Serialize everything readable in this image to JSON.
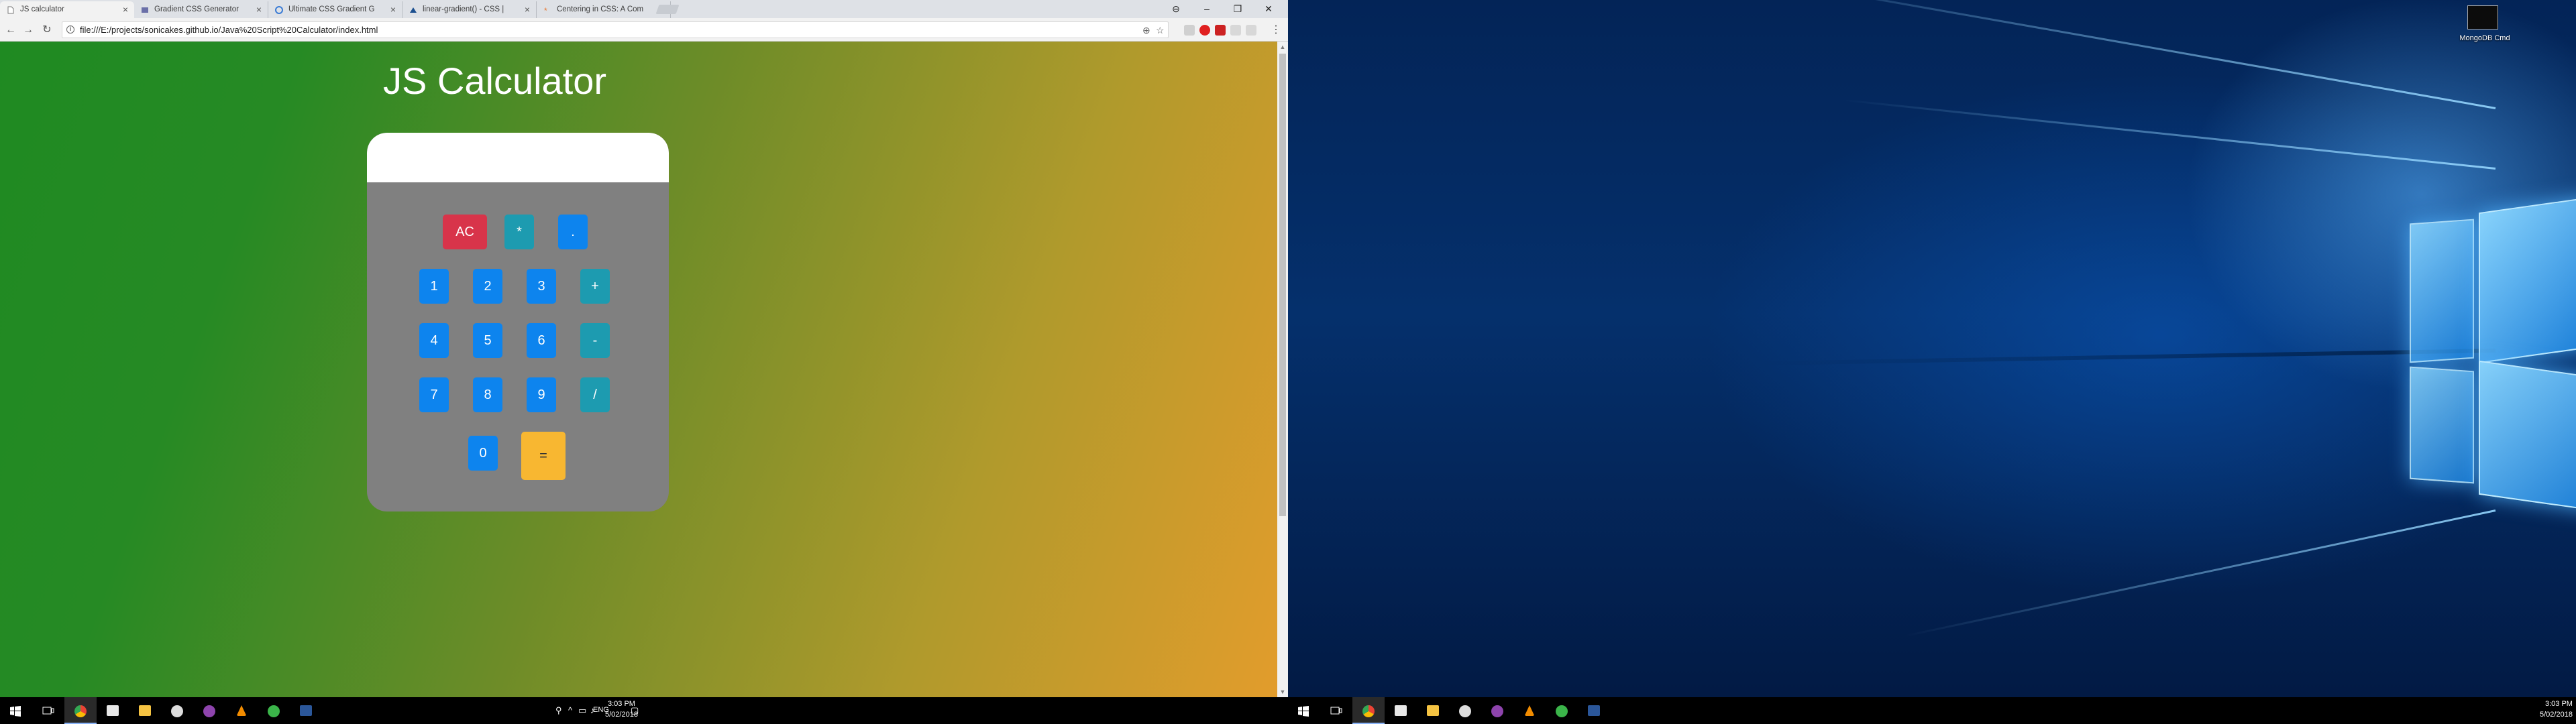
{
  "browser": {
    "tabs": [
      {
        "title": "JS calculator",
        "active": true
      },
      {
        "title": "Gradient CSS Generator",
        "active": false
      },
      {
        "title": "Ultimate CSS Gradient G",
        "active": false
      },
      {
        "title": "linear-gradient() - CSS |",
        "active": false
      },
      {
        "title": "Centering in CSS: A Com",
        "active": false
      }
    ],
    "url": "file:///E:/projects/sonicakes.github.io/Java%20Script%20Calculator/index.html",
    "tab_close_glyph": "×",
    "window_controls": {
      "account": "⊖",
      "minimize": "–",
      "maximize": "❐",
      "close": "✕"
    },
    "nav": {
      "back": "←",
      "forward": "→",
      "reload": "↻"
    },
    "omni_icons": {
      "zoom": "⊕",
      "star": "☆"
    }
  },
  "calculator": {
    "title": "JS Calculator",
    "display_value": "",
    "keys": {
      "ac": "AC",
      "multiply": "*",
      "dot": ".",
      "k1": "1",
      "k2": "2",
      "k3": "3",
      "plus": "+",
      "k4": "4",
      "k5": "5",
      "k6": "6",
      "minus": "-",
      "k7": "7",
      "k8": "8",
      "k9": "9",
      "divide": "/",
      "k0": "0",
      "equals": "="
    }
  },
  "taskbar_left": {
    "language": "ENG",
    "time": "3:03 PM",
    "date": "5/02/2018"
  },
  "taskbar_right": {
    "time": "3:03 PM",
    "date": "5/02/2018"
  },
  "desktop": {
    "icon_label": "MongoDB Cmd"
  },
  "colors": {
    "calc_body": "#808080",
    "key_number": "#0d84ee",
    "key_operator": "#1d9bb0",
    "key_clear": "#d8344a",
    "key_equals": "#f8b731"
  }
}
